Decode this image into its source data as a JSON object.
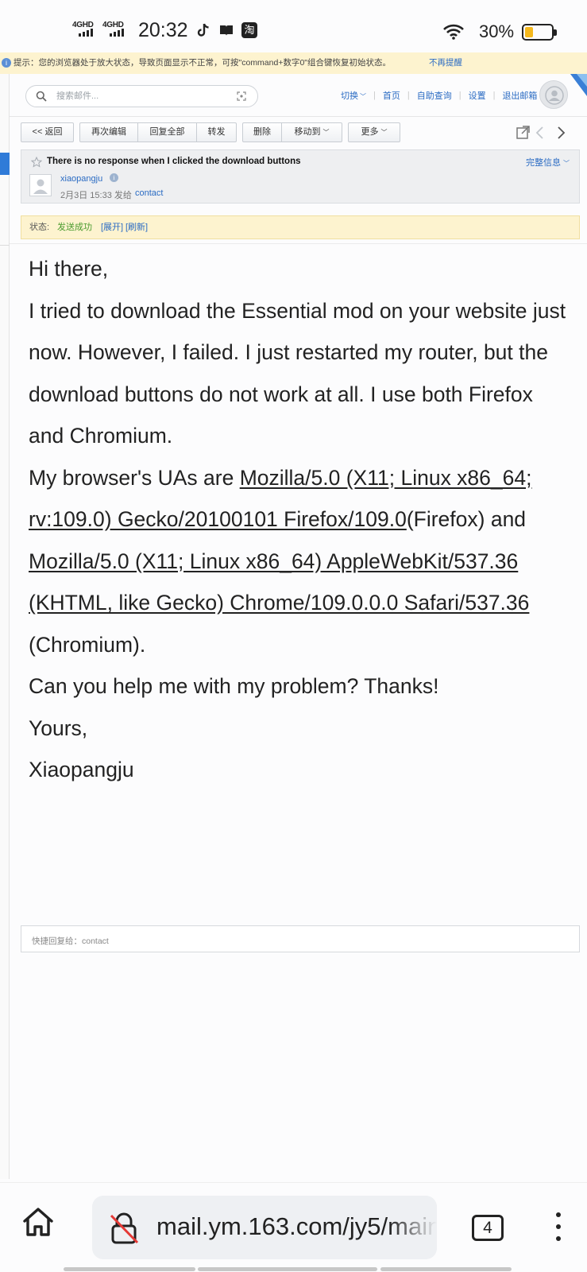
{
  "status_bar": {
    "net1": "4GHD",
    "net2": "4GHD",
    "time": "20:32",
    "app_icons": [
      "tiktok-icon",
      "book-icon",
      "taobao-icon"
    ],
    "taobao_glyph": "淘",
    "battery_percent": "30%",
    "battery_level": 0.3,
    "battery_color": "#f5b81c"
  },
  "notice": {
    "text": "提示：您的浏览器处于放大状态，导致页面显示不正常，可按\"command+数字0\"组合键恢复初始状态。",
    "dismiss": "不再提醒"
  },
  "header": {
    "search_placeholder": "搜索邮件...",
    "nav": {
      "switch": "切换",
      "home": "首页",
      "self_service": "自助查询",
      "settings": "设置",
      "logout": "退出邮箱"
    }
  },
  "toolbar": {
    "back": "<< 返回",
    "edit_again": "再次编辑",
    "reply_all": "回复全部",
    "forward": "转发",
    "delete": "删除",
    "move_to": "移动到",
    "more": "更多"
  },
  "mail": {
    "subject": "There is no response when I clicked the download buttons",
    "full_info": "完整信息",
    "sender": "xiaopangju",
    "date": "2月3日 15:33 发给",
    "recipient": "contact"
  },
  "delivery_status": {
    "label": "状态:",
    "value": "发送成功",
    "expand": "[展开]",
    "refresh": "[刷新]"
  },
  "body": {
    "greeting": "Hi there,",
    "paragraph1": "I tried to download the Essential mod on your website just now. However, I failed. I just restarted my router, but the download buttons do not work at all. I use both Firefox and Chromium.",
    "ua_prefix": "My browser's UAs are ",
    "ua_firefox": "Mozilla/5.0 (X11; Linux x86_64; rv:109.0) Gecko/20100101 Firefox/109.0",
    "ua_firefox_suffix": "(Firefox) and",
    "ua_chromium": " Mozilla/5.0 (X11; Linux x86_64) AppleWebKit/537.36 (KHTML, like Gecko) Chrome/109.0.0.0 Safari/537.36",
    "ua_chromium_suffix": " (Chromium).",
    "question": "Can you help me with my problem? Thanks!",
    "closing": "Yours,",
    "signature": "Xiaopangju"
  },
  "quick_reply": {
    "label": "快捷回复给：contact"
  },
  "browser": {
    "url": "mail.ym.163.com/jy5/main",
    "tab_count": "4"
  },
  "colors": {
    "link_blue": "#2a6bc3",
    "notice_bg": "#fdf3cf",
    "success_green": "#4a9b2e",
    "sidebar_accent": "#2f7bd8"
  }
}
